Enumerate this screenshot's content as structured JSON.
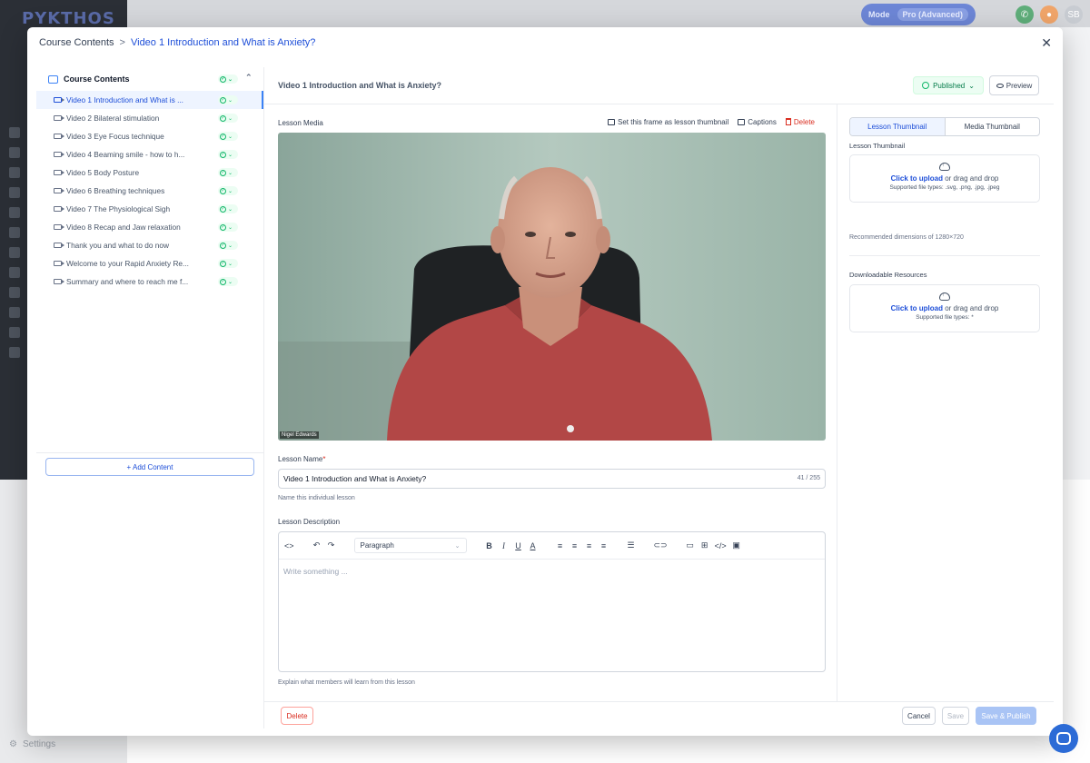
{
  "background": {
    "logo": "PYKTHOS",
    "mode_label": "Mode",
    "mode_value": "Pro (Advanced)",
    "avatar_initials": "SB",
    "settings_label": "Settings"
  },
  "breadcrumb": {
    "root": "Course Contents",
    "separator": ">",
    "current": "Video 1 Introduction and What is Anxiety?"
  },
  "sidebar": {
    "root_label": "Course Contents",
    "lessons": [
      {
        "label": "Video 1 Introduction and What is ..."
      },
      {
        "label": "Video 2 Bilateral stimulation"
      },
      {
        "label": "Video 3 Eye Focus technique"
      },
      {
        "label": "Video 4 Beaming smile - how to h..."
      },
      {
        "label": "Video 5 Body Posture"
      },
      {
        "label": "Video 6 Breathing techniques"
      },
      {
        "label": "Video 7 The Physiological Sigh"
      },
      {
        "label": "Video 8 Recap and Jaw relaxation"
      },
      {
        "label": "Thank you and what to do now"
      },
      {
        "label": "Welcome to your Rapid Anxiety Re..."
      },
      {
        "label": "Summary and where to reach me f..."
      }
    ],
    "add_content": "+ Add Content"
  },
  "lesson_header": {
    "title": "Video 1 Introduction and What is Anxiety?",
    "status": "Published",
    "preview": "Preview"
  },
  "media": {
    "label": "Lesson Media",
    "set_thumbnail": "Set this frame as lesson thumbnail",
    "captions": "Captions",
    "delete": "Delete",
    "speaker_name": "Nigel Edwards"
  },
  "lesson_name": {
    "label": "Lesson Name",
    "required_mark": "*",
    "value": "Video 1 Introduction and What is Anxiety?",
    "counter": "41 / 255",
    "hint": "Name this individual lesson"
  },
  "description": {
    "label": "Lesson Description",
    "paragraph_style": "Paragraph",
    "placeholder": "Write something ...",
    "hint": "Explain what members will learn from this lesson"
  },
  "right_panel": {
    "tabs": [
      "Lesson Thumbnail",
      "Media Thumbnail"
    ],
    "thumbnail_label": "Lesson Thumbnail",
    "upload_cta": "Click to upload",
    "upload_rest": " or drag and drop",
    "thumbnail_types": "Supported file types: .svg, .png, .jpg, .jpeg",
    "recommended": "Recommended dimensions of 1280×720",
    "resources_label": "Downloadable Resources",
    "resources_types": "Supported file types: *"
  },
  "footer": {
    "delete": "Delete",
    "cancel": "Cancel",
    "save": "Save",
    "save_publish": "Save & Publish"
  },
  "colors": {
    "accent": "#1d4ed8",
    "success": "#12b76a",
    "danger": "#d92d20",
    "shirt": "#b24746"
  }
}
